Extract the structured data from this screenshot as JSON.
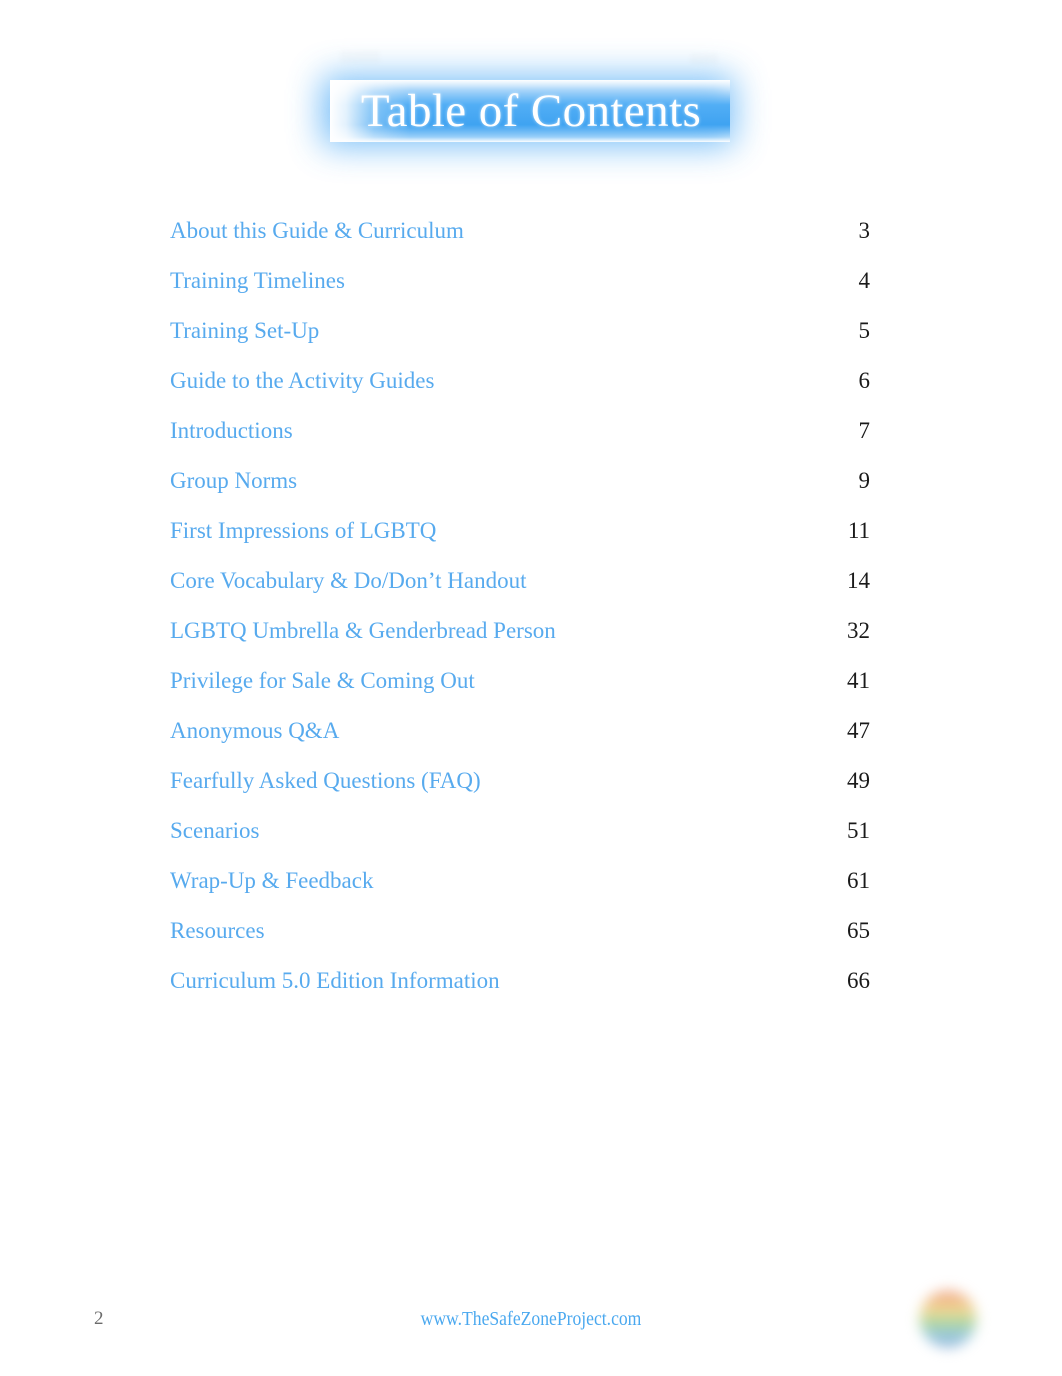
{
  "document": {
    "title": "Table of Contents",
    "page_number": "2",
    "footer_url": "www.TheSafeZoneProject.com"
  },
  "colors": {
    "title_bar_blue": "#42a5f5",
    "entry_blue": "#57aaee",
    "page_number_dark": "#1a1a1a",
    "footer_page_gray": "#6b6b6b",
    "footer_url_blue": "#4aa8ef"
  },
  "toc": {
    "entries": [
      {
        "title": "About this Guide & Curriculum",
        "page": "3"
      },
      {
        "title": "Training Timelines",
        "page": "4"
      },
      {
        "title": "Training Set-Up",
        "page": "5"
      },
      {
        "title": "Guide to the Activity Guides",
        "page": "6"
      },
      {
        "title": "Introductions",
        "page": "7"
      },
      {
        "title": "Group Norms",
        "page": "9"
      },
      {
        "title": "First Impressions of LGBTQ",
        "page": "11"
      },
      {
        "title": "Core Vocabulary & Do/Don’t Handout",
        "page": "14"
      },
      {
        "title": "LGBTQ Umbrella & Genderbread Person",
        "page": "32"
      },
      {
        "title": "Privilege for Sale & Coming Out",
        "page": "41"
      },
      {
        "title": "Anonymous Q&A",
        "page": "47"
      },
      {
        "title": "Fearfully Asked Questions (FAQ)",
        "page": "49"
      },
      {
        "title": "Scenarios",
        "page": "51"
      },
      {
        "title": "Wrap-Up & Feedback",
        "page": "61"
      },
      {
        "title": "Resources",
        "page": "65"
      },
      {
        "title": "Curriculum 5.0 Edition Information",
        "page": "66"
      }
    ]
  },
  "logo": {
    "name": "rainbow-circle-logo"
  }
}
